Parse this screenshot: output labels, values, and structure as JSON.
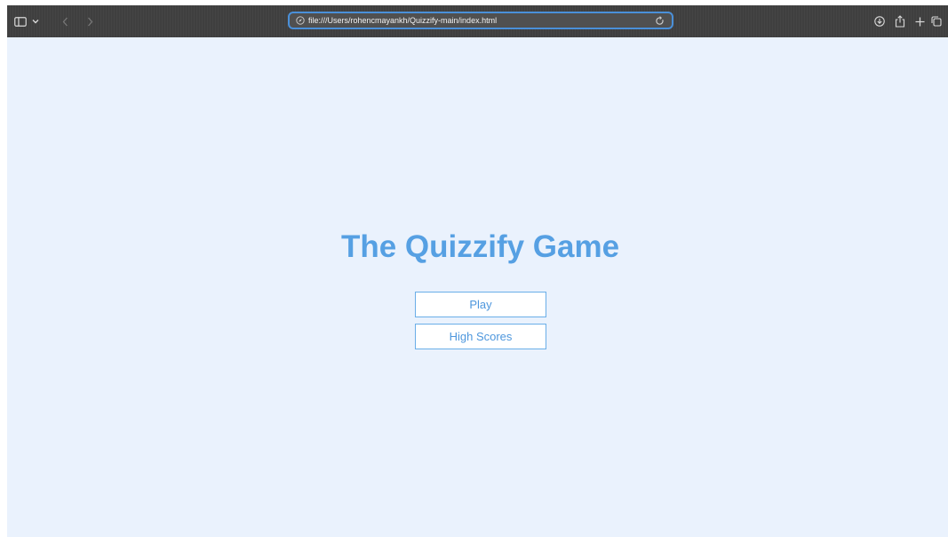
{
  "browser": {
    "url": "file:///Users/rohencmayankh/Quizzify-main/index.html",
    "icons": {
      "sidebar": "sidebar-icon",
      "sidebar_menu": "chevron-down-icon",
      "back": "chevron-left-icon",
      "forward": "chevron-right-icon",
      "site_info": "compass-icon",
      "reload": "reload-icon",
      "downloads": "download-icon",
      "share": "share-icon",
      "new_tab": "plus-icon",
      "tab_overview": "tabs-icon"
    },
    "accent_color": "#4a90d9"
  },
  "page": {
    "title": "The Quizzify Game",
    "buttons": {
      "play": "Play",
      "high_scores": "High Scores"
    },
    "colors": {
      "background": "#eaf2fd",
      "title": "#56a0e3",
      "button_text": "#4e97dd",
      "button_border": "#6aaee8"
    }
  }
}
